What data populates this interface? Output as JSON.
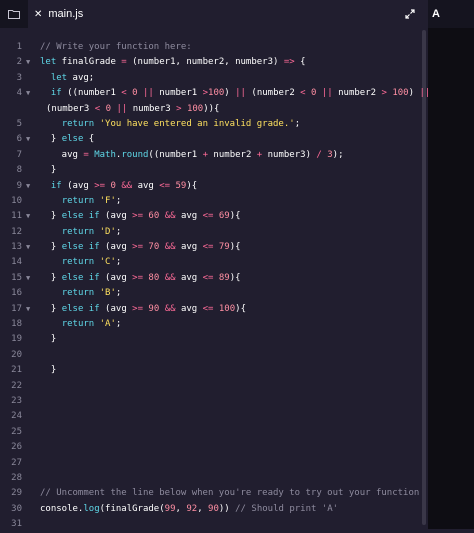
{
  "toolbar": {
    "folder_icon": "folder-icon",
    "expand_icon": "expand-icon"
  },
  "tab": {
    "close_glyph": "✕",
    "filename": "main.js"
  },
  "right_panel": {
    "label": "A"
  },
  "editor": {
    "line_numbers": [
      "1",
      "2",
      "3",
      "4",
      "5",
      "6",
      "7",
      "8",
      "9",
      "10",
      "11",
      "12",
      "13",
      "14",
      "15",
      "16",
      "17",
      "18",
      "19",
      "20",
      "21",
      "22",
      "23",
      "24",
      "25",
      "26",
      "27",
      "28",
      "29",
      "30",
      "31"
    ],
    "fold_lines": [
      2,
      4,
      6,
      9,
      11,
      13,
      15,
      17
    ],
    "lines": [
      "// Write your function here:",
      "let finalGrade = (number1, number2, number3) => {",
      "  let avg;",
      "  if ((number1 < 0 || number1 >100) || (number2 < 0 || number2 > 100) ||",
      "(number3 < 0 || number3 > 100)){",
      "    return 'You have entered an invalid grade.';",
      "  } else {",
      "    avg = Math.round((number1 + number2 + number3) / 3);",
      "  }",
      "  if (avg >= 0 && avg <= 59){",
      "    return 'F';",
      "  } else if (avg >= 60 && avg <= 69){",
      "    return 'D';",
      "  } else if (avg >= 70 && avg <= 79){",
      "    return 'C';",
      "  } else if (avg >= 80 && avg <= 89){",
      "    return 'B';",
      "  } else if (avg >= 90 && avg <= 100){",
      "    return 'A';",
      "  }",
      "",
      "  }",
      "",
      "",
      "",
      "",
      "",
      "",
      "",
      "// Uncomment the line below when you're ready to try out your function",
      "console.log(finalGrade(99, 92, 90)) // Should print 'A'",
      ""
    ]
  },
  "colors": {
    "background": "#211e2f",
    "comment": "#8e8b9e",
    "keyword": "#5fd8e8",
    "string": "#fde05f",
    "number": "#ff8fa3",
    "operator": "#ff6b98"
  }
}
